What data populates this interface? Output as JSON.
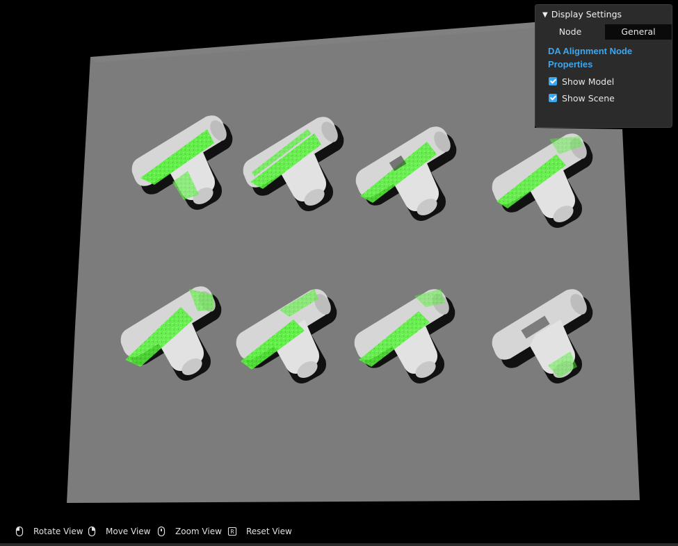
{
  "panel": {
    "header": "Display Settings",
    "tabs": [
      {
        "label": "Node",
        "active": false
      },
      {
        "label": "General",
        "active": true
      }
    ],
    "properties_title": "DA Alignment Node Properties",
    "checkboxes": [
      {
        "label": "Show Model",
        "checked": true
      },
      {
        "label": "Show Scene",
        "checked": true
      }
    ],
    "accent_color": "#3aa7f2"
  },
  "toolbar": {
    "items": [
      {
        "label": "Rotate View",
        "icon": "mouse-left-icon"
      },
      {
        "label": "Move View",
        "icon": "mouse-right-icon"
      },
      {
        "label": "Zoom View",
        "icon": "mouse-wheel-icon"
      },
      {
        "label": "Reset View",
        "icon": "r-key-icon"
      }
    ]
  },
  "scene": {
    "object_count": 8,
    "model_color": "#55f038",
    "object_color": "#d9d9d9",
    "board_color": "#7f7f7f"
  }
}
